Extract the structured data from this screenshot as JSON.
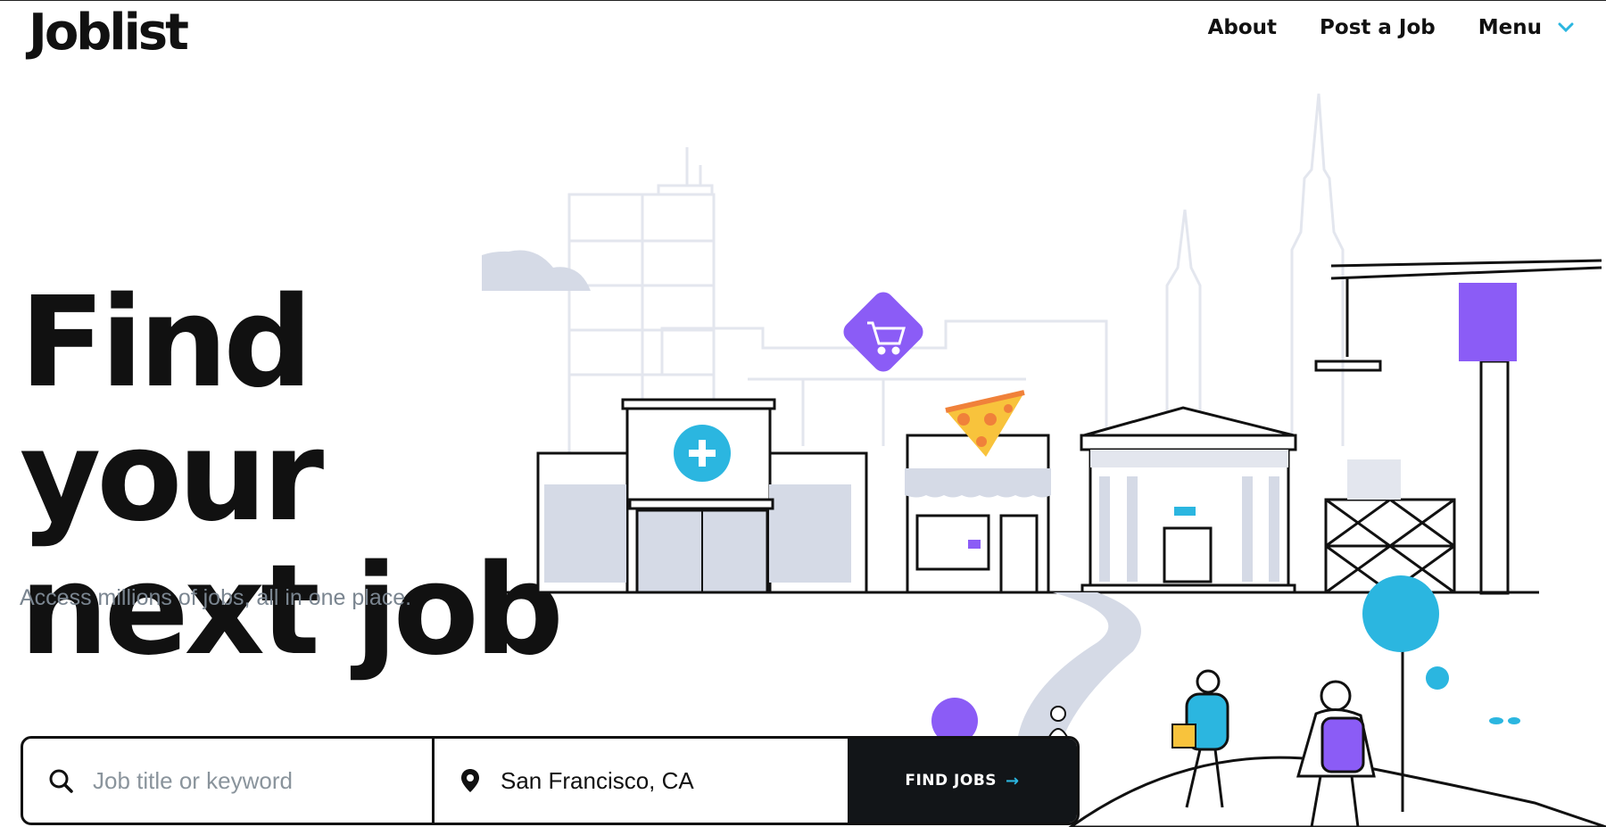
{
  "header": {
    "logo": "Joblist",
    "nav": {
      "about": "About",
      "post_job": "Post a Job",
      "menu": "Menu"
    }
  },
  "hero": {
    "headline_line1": "Find your",
    "headline_line2": "next job",
    "subtitle": "Access millions of jobs, all in one place."
  },
  "search": {
    "keyword_placeholder": "Job title or keyword",
    "keyword_value": "",
    "location_value": "San Francisco, CA",
    "button_label": "FIND JOBS",
    "button_arrow": "→"
  },
  "illustration": {
    "icons": [
      "cart-icon",
      "pizza-icon",
      "medical-cross-icon"
    ],
    "colors": {
      "accent_blue": "#2bb6e0",
      "accent_purple": "#8b5cf6",
      "pizza_yellow": "#f8c33c",
      "pizza_dot": "#f0813a",
      "muted": "#d5dae6"
    }
  }
}
